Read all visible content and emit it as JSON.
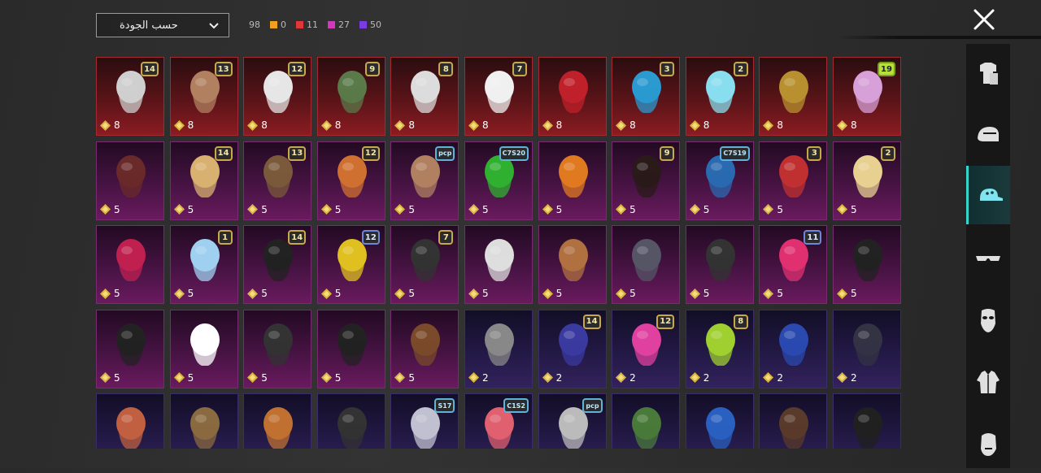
{
  "sort": {
    "label": "حسب الجودة"
  },
  "stats": {
    "total": "98",
    "breakdown": [
      {
        "value": "0",
        "color": "#f0a020"
      },
      {
        "value": "11",
        "color": "#e03838"
      },
      {
        "value": "27",
        "color": "#d03ab8"
      },
      {
        "value": "50",
        "color": "#7a3ce0"
      }
    ]
  },
  "grid": {
    "tiles": [
      {
        "tier": "red",
        "count": "8",
        "badge": "14",
        "icon": "cat-ear-hat-icon"
      },
      {
        "tier": "red",
        "count": "8",
        "badge": "13",
        "icon": "floppy-hat-hair-icon"
      },
      {
        "tier": "red",
        "count": "8",
        "badge": "12",
        "icon": "bunny-ear-hair-icon"
      },
      {
        "tier": "red",
        "count": "8",
        "badge": "9",
        "icon": "zombie-head-icon"
      },
      {
        "tier": "red",
        "count": "8",
        "badge": "8",
        "icon": "white-hair-icon"
      },
      {
        "tier": "red",
        "count": "8",
        "badge": "7",
        "icon": "white-long-hair-icon"
      },
      {
        "tier": "red",
        "count": "8",
        "badge": "",
        "icon": "red-mask-icon"
      },
      {
        "tier": "red",
        "count": "8",
        "badge": "3",
        "icon": "blue-curly-hair-icon"
      },
      {
        "tier": "red",
        "count": "8",
        "badge": "2",
        "icon": "cyan-hat-icon"
      },
      {
        "tier": "red",
        "count": "8",
        "badge": "",
        "icon": "anubis-mask-icon"
      },
      {
        "tier": "red",
        "count": "8",
        "badge": "19",
        "badgeStyle": "green",
        "icon": "horned-mask-icon"
      },
      {
        "tier": "pink",
        "count": "5",
        "badge": "",
        "icon": "brown-hair-icon"
      },
      {
        "tier": "pink",
        "count": "5",
        "badge": "14",
        "icon": "blonde-hair-icon"
      },
      {
        "tier": "pink",
        "count": "5",
        "badge": "13",
        "icon": "aviator-goggles-icon"
      },
      {
        "tier": "pink",
        "count": "5",
        "badge": "12",
        "icon": "orange-hair-icon"
      },
      {
        "tier": "pink",
        "count": "5",
        "badge": "pcp",
        "badgeStyle": "code",
        "icon": "animal-mask-icon"
      },
      {
        "tier": "pink",
        "count": "5",
        "badge": "C7S20",
        "badgeStyle": "code",
        "icon": "green-hair-icon"
      },
      {
        "tier": "pink",
        "count": "5",
        "badge": "",
        "icon": "pumpkin-head-icon"
      },
      {
        "tier": "pink",
        "count": "5",
        "badge": "9",
        "icon": "dark-hair-icon"
      },
      {
        "tier": "pink",
        "count": "5",
        "badge": "C7S19",
        "badgeStyle": "code",
        "icon": "feather-headdress-icon"
      },
      {
        "tier": "pink",
        "count": "5",
        "badge": "3",
        "icon": "jester-hat-icon"
      },
      {
        "tier": "pink",
        "count": "5",
        "badge": "2",
        "icon": "white-headband-hair-icon"
      },
      {
        "tier": "pink",
        "count": "5",
        "badge": "",
        "icon": "mohawk-helmet-icon"
      },
      {
        "tier": "pink",
        "count": "5",
        "badge": "1",
        "icon": "twin-tail-hair-icon"
      },
      {
        "tier": "pink",
        "count": "5",
        "badge": "14",
        "icon": "gold-band-hair-icon"
      },
      {
        "tier": "pink",
        "count": "5",
        "badge": "12",
        "badgeStyle": "blue",
        "icon": "yellow-mascot-helmet-icon"
      },
      {
        "tier": "pink",
        "count": "5",
        "badge": "7",
        "icon": "peaked-cap-icon"
      },
      {
        "tier": "pink",
        "count": "5",
        "badge": "",
        "icon": "white-dreadlocks-icon"
      },
      {
        "tier": "pink",
        "count": "5",
        "badge": "",
        "icon": "cowboy-hat-icon"
      },
      {
        "tier": "pink",
        "count": "5",
        "badge": "",
        "icon": "visor-helmet-icon"
      },
      {
        "tier": "pink",
        "count": "5",
        "badge": "",
        "icon": "bandana-icon"
      },
      {
        "tier": "pink",
        "count": "5",
        "badge": "11",
        "badgeStyle": "blue",
        "icon": "pink-cap-icon"
      },
      {
        "tier": "pink",
        "count": "5",
        "badge": "",
        "icon": "black-tricorn-icon"
      },
      {
        "tier": "pink",
        "count": "5",
        "badge": "",
        "icon": "officer-cap-icon"
      },
      {
        "tier": "pink",
        "count": "5",
        "badge": "",
        "icon": "white-bow-icon"
      },
      {
        "tier": "pink",
        "count": "5",
        "badge": "",
        "icon": "hair-band-icon"
      },
      {
        "tier": "pink",
        "count": "5",
        "badge": "",
        "icon": "dark-ribbon-icon"
      },
      {
        "tier": "pink",
        "count": "5",
        "badge": "",
        "icon": "bear-mask-icon"
      },
      {
        "tier": "purple",
        "count": "2",
        "badge": "",
        "icon": "gray-hair-icon"
      },
      {
        "tier": "purple",
        "count": "2",
        "badge": "14",
        "icon": "blue-cat-cap-icon"
      },
      {
        "tier": "purple",
        "count": "2",
        "badge": "12",
        "icon": "bunny-helmet-icon"
      },
      {
        "tier": "purple",
        "count": "2",
        "badge": "8",
        "icon": "green-skull-hood-icon"
      },
      {
        "tier": "purple",
        "count": "2",
        "badge": "",
        "icon": "baseball-cap-icon"
      },
      {
        "tier": "purple",
        "count": "2",
        "badge": "",
        "icon": "tactical-helmet-icon"
      },
      {
        "tier": "purple",
        "count": "",
        "badge": "",
        "icon": "aviator-cap-icon"
      },
      {
        "tier": "purple",
        "count": "",
        "badge": "",
        "icon": "braided-hair-icon"
      },
      {
        "tier": "purple",
        "count": "",
        "badge": "",
        "icon": "orange-helmet-icon"
      },
      {
        "tier": "purple",
        "count": "",
        "badge": "",
        "icon": "mesh-cap-icon"
      },
      {
        "tier": "purple",
        "count": "",
        "badge": "S17",
        "badgeStyle": "code",
        "icon": "winged-helmet-icon"
      },
      {
        "tier": "purple",
        "count": "",
        "badge": "C1S2",
        "badgeStyle": "code",
        "icon": "striped-beanie-icon"
      },
      {
        "tier": "purple",
        "count": "",
        "badge": "pcp",
        "badgeStyle": "code",
        "icon": "silver-hair-icon"
      },
      {
        "tier": "purple",
        "count": "",
        "badge": "",
        "icon": "green-helmet-icon"
      },
      {
        "tier": "purple",
        "count": "",
        "badge": "",
        "icon": "cricket-helmet-icon"
      },
      {
        "tier": "purple",
        "count": "",
        "badge": "",
        "icon": "goggle-hat-icon"
      },
      {
        "tier": "purple",
        "count": "",
        "badge": "",
        "icon": "ponytail-helmet-icon"
      }
    ]
  },
  "categories": [
    {
      "icon": "outfit-icon",
      "active": false
    },
    {
      "icon": "helmet-icon",
      "active": false
    },
    {
      "icon": "cap-icon",
      "active": true
    },
    {
      "icon": "glasses-icon",
      "active": false
    },
    {
      "icon": "mask-icon",
      "active": false
    },
    {
      "icon": "jacket-icon",
      "active": false
    },
    {
      "icon": "face-icon",
      "active": false
    }
  ]
}
